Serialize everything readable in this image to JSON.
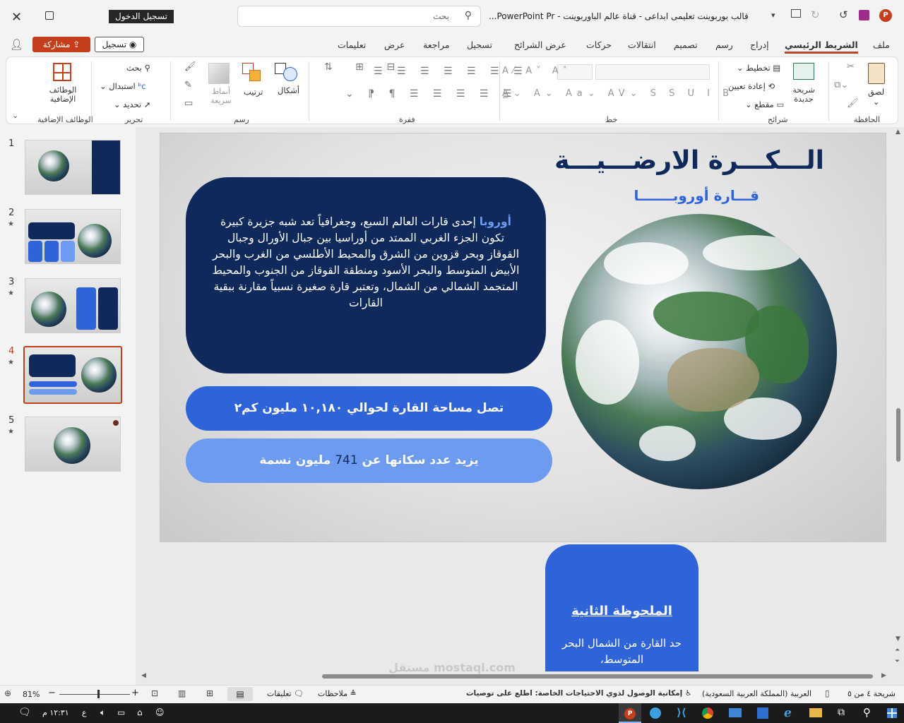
{
  "titlebar": {
    "title": "قالب بوربوينت تعليمى ابداعى - قناة عالم الباوربوينت  -  PowerPoint Pr...",
    "search_placeholder": "بحث",
    "signin_label": "تسجيل الدخول"
  },
  "ribbon_tabs": [
    "ملف",
    "الشريط الرئيسي",
    "إدراج",
    "رسم",
    "تصميم",
    "انتقالات",
    "حركات",
    "عرض الشرائح",
    "تسجيل",
    "مراجعة",
    "عرض",
    "تعليمات"
  ],
  "share_label": "مشاركة",
  "record_label": "تسجيل",
  "ribbon": {
    "clipboard": {
      "paste": "لصق",
      "group": "الحافظة"
    },
    "slides": {
      "new_slide": "شريحة جديدة",
      "layout": "تخطيط",
      "reset": "إعادة تعيين",
      "section": "مقطع",
      "group": "شرائح"
    },
    "font": {
      "group": "خط"
    },
    "paragraph": {
      "group": "فقرة"
    },
    "drawing": {
      "shapes": "أشكال",
      "arrange": "ترتيب",
      "quick_styles": "أنماط سريعة",
      "group": "رسم"
    },
    "editing": {
      "find": "بحث",
      "replace": "استبدال",
      "select": "تحديد",
      "group": "تحرير"
    },
    "addins": {
      "label": "الوظائف الإضافية",
      "group": "الوظائف الإضافية"
    }
  },
  "thumbnails": [
    {
      "number": "1",
      "star": ""
    },
    {
      "number": "2",
      "star": "★"
    },
    {
      "number": "3",
      "star": "★"
    },
    {
      "number": "4",
      "star": "★"
    },
    {
      "number": "5",
      "star": "★"
    }
  ],
  "slide": {
    "title": "الـــكـــرة الارضـــيـــة",
    "subtitle": "قـــارة أوروبـــــــا",
    "body_highlight": "أوروبا",
    "body": " إحدى قارات العالم السبع، وجغرافياً تعد شبه جزيرة كبيرة تكون الجزء الغربي الممتد من أوراسيا بين جبال الأورال وجبال القوقاز وبحر قزوين من الشرق والمحيط الأطلسي من الغرب والبحر الأبيض المتوسط والبحر الأسود ومنطقة القوقاز من الجنوب والمحيط المتجمد الشمالي من الشمال، وتعتبر قارة صغيرة نسبياً مقارنة ببقية القارات",
    "fact1": "تصل مساحة القارة لحوالي ١٠,١٨٠ مليون كم٢",
    "fact2_pre": "يزيد عدد سكانها عن",
    "fact2_num": "741",
    "fact2_post": "مليون نسمة"
  },
  "note_card": {
    "title": "الملحوظة الثانية",
    "text": "حد القارة من الشمال البحر المتوسط،"
  },
  "statusbar": {
    "slide_count": "شريحة ٤ من ٥",
    "language": "العربية (المملكة العربية السعودية)",
    "accessibility": "إمكانية الوصول لذوي الاحتياجات الخاصة: اطلع على توصيات",
    "notes": "ملاحظات",
    "comments": "تعليقات",
    "zoom": "81%"
  },
  "taskbar": {
    "time": "١٢:٣١ م",
    "lang": "ع"
  },
  "watermark": "مستقل mostaql.com",
  "colors": {
    "accent": "#b7472a",
    "navy": "#0f2a5a",
    "blue": "#2f63d8",
    "lightblue": "#6c9bf0"
  }
}
